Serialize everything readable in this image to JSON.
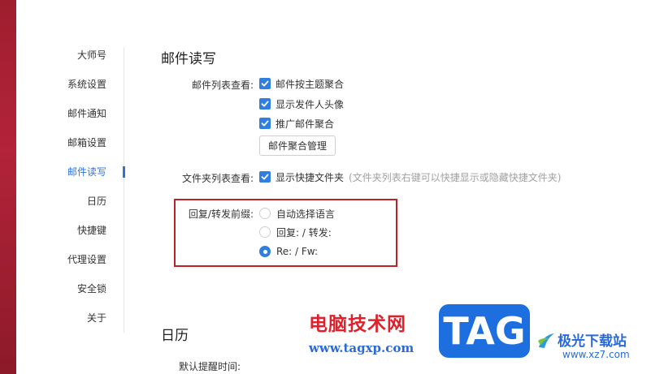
{
  "sidebar": {
    "items": [
      {
        "label": "大师号",
        "active": false
      },
      {
        "label": "系统设置",
        "active": false
      },
      {
        "label": "邮件通知",
        "active": false
      },
      {
        "label": "邮箱设置",
        "active": false
      },
      {
        "label": "邮件读写",
        "active": true
      },
      {
        "label": "日历",
        "active": false
      },
      {
        "label": "快捷键",
        "active": false
      },
      {
        "label": "代理设置",
        "active": false
      },
      {
        "label": "安全锁",
        "active": false
      },
      {
        "label": "关于",
        "active": false
      }
    ]
  },
  "mail_section": {
    "title": "邮件读写",
    "list_view": {
      "label": "邮件列表查看:",
      "options": [
        {
          "label": "邮件按主题聚合",
          "checked": true
        },
        {
          "label": "显示发件人头像",
          "checked": true
        },
        {
          "label": "推广邮件聚合",
          "checked": true
        }
      ],
      "button_label": "邮件聚合管理"
    },
    "folder_view": {
      "label": "文件夹列表查看:",
      "option": {
        "label": "显示快捷文件夹",
        "checked": true
      },
      "hint": "(文件夹列表右键可以快捷显示或隐藏快捷文件夹)"
    },
    "reply_prefix": {
      "label": "回复/转发前缀:",
      "options": [
        {
          "label": "自动选择语言",
          "selected": false
        },
        {
          "label": "回复: / 转发:",
          "selected": false
        },
        {
          "label": "Re: / Fw:",
          "selected": true
        }
      ]
    }
  },
  "calendar_section": {
    "title": "日历",
    "reminder_label": "默认提醒时间:"
  },
  "watermark": {
    "cn_text": "电脑技术网",
    "url": "www.tagxp.com",
    "tag": "TAG",
    "brand_cn": "极光下载站",
    "brand_url": "www.xz7.com"
  },
  "colors": {
    "accent": "#2f7ee0",
    "active_nav": "#2e73d4",
    "highlight_border": "#c0202a",
    "left_strip": "#b3233a"
  }
}
